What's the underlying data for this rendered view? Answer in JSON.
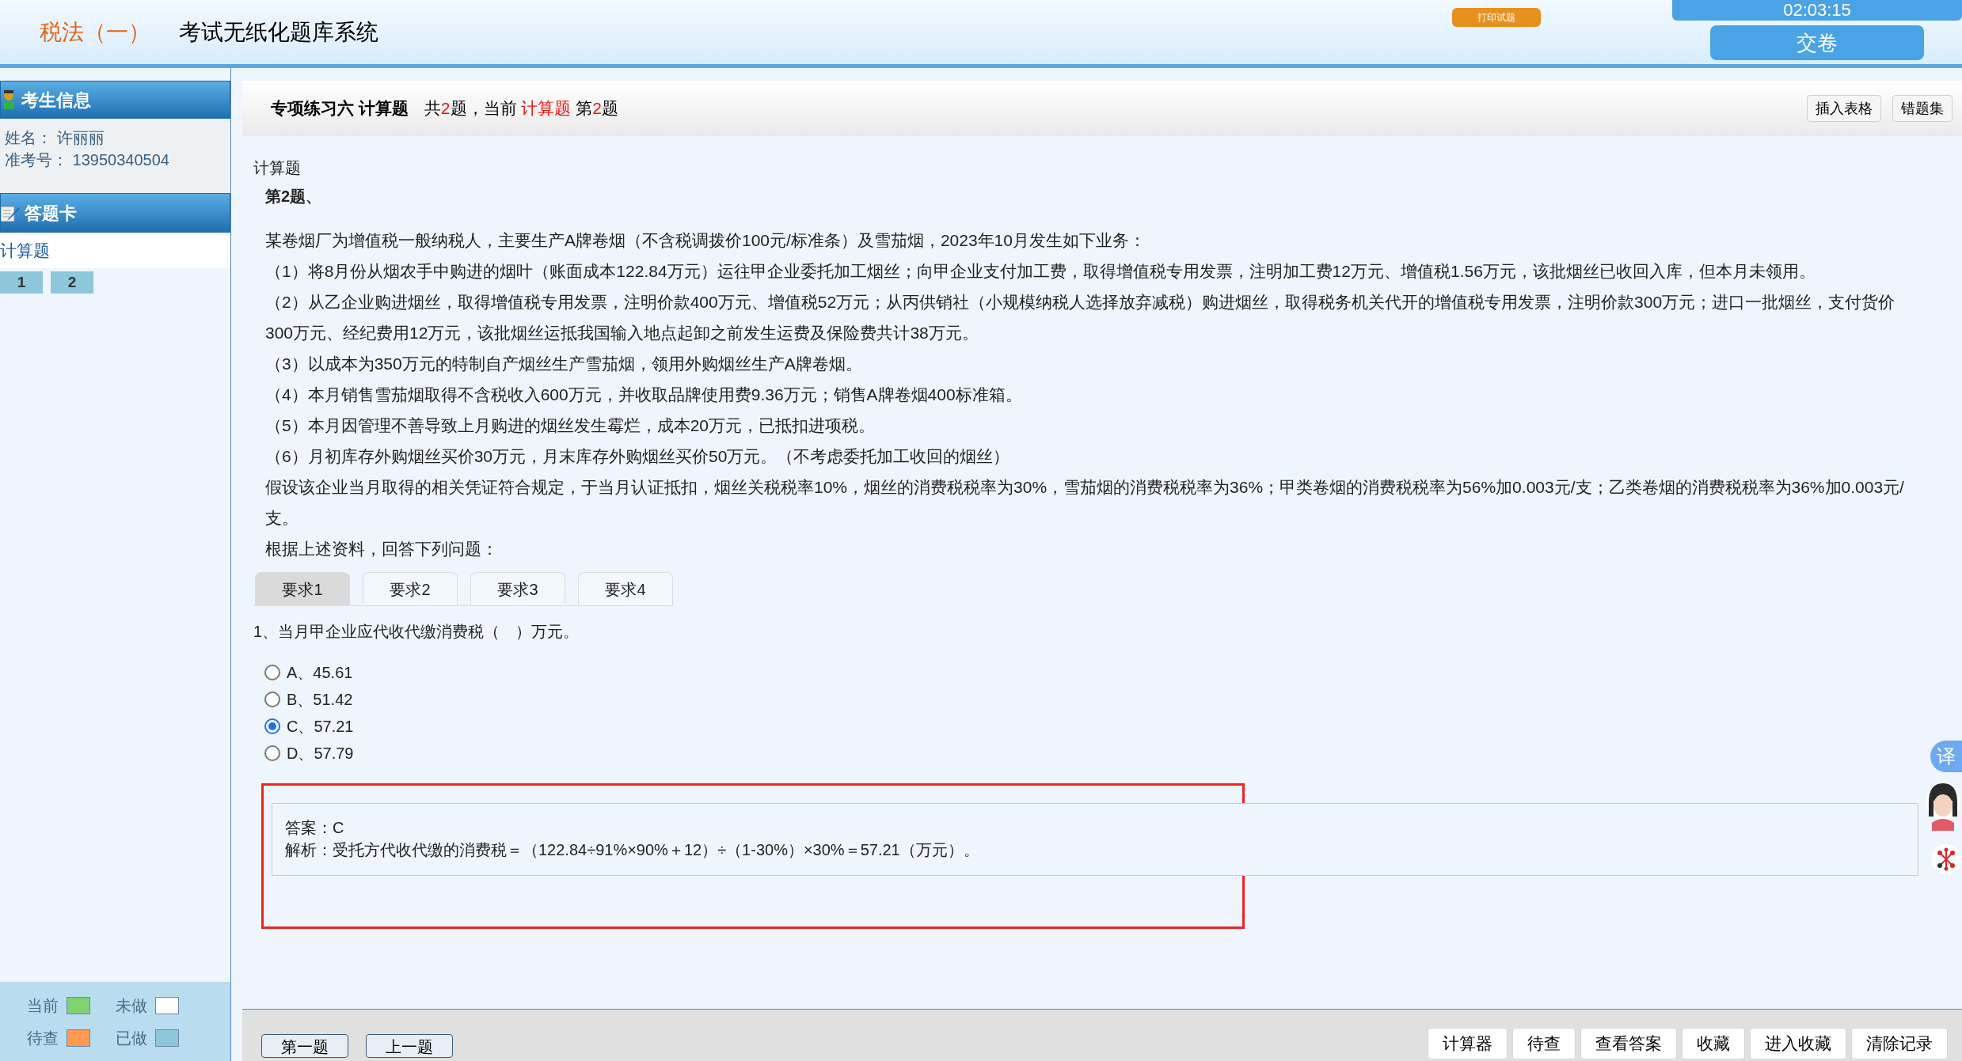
{
  "header": {
    "subject": "税法（一）",
    "title": "考试无纸化题库系统",
    "print_button": "打印试题",
    "timer": "02:03:15",
    "submit_button": "交卷"
  },
  "sidebar": {
    "candidate_title": "考生信息",
    "fields": [
      {
        "label": "姓名：",
        "value": "许丽丽"
      },
      {
        "label": "准考号：",
        "value": "13950340504"
      }
    ],
    "answer_card_title": "答题卡",
    "section": "计算题",
    "questions": [
      {
        "label": "1"
      },
      {
        "label": "2"
      }
    ],
    "legend": [
      {
        "label": "当前",
        "color": "#7dd36f"
      },
      {
        "label": "未做",
        "color": "#ffffff"
      },
      {
        "label": "待查",
        "color": "#ff9a50"
      },
      {
        "label": "已做",
        "color": "#8ec7dc"
      }
    ]
  },
  "toolbar": {
    "title": "专项练习六 计算题",
    "status": [
      {
        "text": "共",
        "highlight": false
      },
      {
        "text": "2",
        "highlight": true
      },
      {
        "text": "题，当前 ",
        "highlight": false
      },
      {
        "text": "计算题",
        "highlight": true
      },
      {
        "text": " 第",
        "highlight": false
      },
      {
        "text": "2",
        "highlight": true
      },
      {
        "text": "题",
        "highlight": false
      }
    ],
    "buttons": [
      "插入表格",
      "错题集"
    ]
  },
  "question": {
    "type": "计算题",
    "number": "第2题、",
    "paragraphs": [
      {
        "text": "某卷烟厂为增值税一般纳税人，主要生产A牌卷烟（不含税调拨价100元/标准条）及雪茄烟，2023年10月发生如下业务："
      },
      {
        "text": "（1）将8月份从烟农手中购进的烟叶（账面成本122.84万元）运往甲企业委托加工烟丝；向甲企业支付加工费，取得增值税专用发票，注明加工费12万元、增值税1.56万元，该批烟丝已收回入库，但本月未领用。"
      },
      {
        "text": "（2）从乙企业购进烟丝，取得增值税专用发票，注明价款400万元、增值税52万元；从丙供销社（小规模纳税人选择放弃减税）购进烟丝，取得税务机关代开的增值税专用发票，注明价款300万元；进口一批烟丝，支付货价300万元、经纪费用12万元，该批烟丝运抵我国输入地点起卸之前发生运费及保险费共计38万元。"
      },
      {
        "text": "（3）以成本为350万元的特制自产烟丝生产雪茄烟，领用外购烟丝生产A牌卷烟。"
      },
      {
        "text": "（4）本月销售雪茄烟取得不含税收入600万元，并收取品牌使用费9.36万元；销售A牌卷烟400标准箱。"
      },
      {
        "text": "（5）本月因管理不善导致上月购进的烟丝发生霉烂，成本20万元，已抵扣进项税。"
      },
      {
        "text": "（6）月初库存外购烟丝买价30万元，月末库存外购烟丝买价50万元。（不考虑委托加工收回的烟丝）"
      },
      {
        "text": "假设该企业当月取得的相关凭证符合规定，于当月认证抵扣，烟丝关税税率10%，烟丝的消费税税率为30%，雪茄烟的消费税税率为36%；甲类卷烟的消费税税率为56%加0.003元/支；乙类卷烟的消费税税率为36%加0.003元/支。"
      },
      {
        "text": "根据上述资料，回答下列问题："
      }
    ],
    "tabs": [
      {
        "label": "要求1",
        "selected": true
      },
      {
        "label": "要求2",
        "selected": false
      },
      {
        "label": "要求3",
        "selected": false
      },
      {
        "label": "要求4",
        "selected": false
      }
    ],
    "prompt": "1、当月甲企业应代收代缴消费税（　）万元。",
    "options": [
      {
        "label": "A、45.61",
        "selected": false
      },
      {
        "label": "B、51.42",
        "selected": false
      },
      {
        "label": "C、57.21",
        "selected": true
      },
      {
        "label": "D、57.79",
        "selected": false
      }
    ],
    "answer": "答案：C",
    "analysis": "解析：受托方代收代缴的消费税＝（122.84÷91%×90%＋12）÷（1-30%）×30%＝57.21（万元）。"
  },
  "floating": {
    "translate": "译"
  },
  "footer": {
    "left_buttons": [
      "第一题",
      "上一题"
    ],
    "right_buttons": [
      "计算器",
      "待查",
      "查看答案",
      "收藏",
      "进入收藏",
      "清除记录"
    ]
  }
}
